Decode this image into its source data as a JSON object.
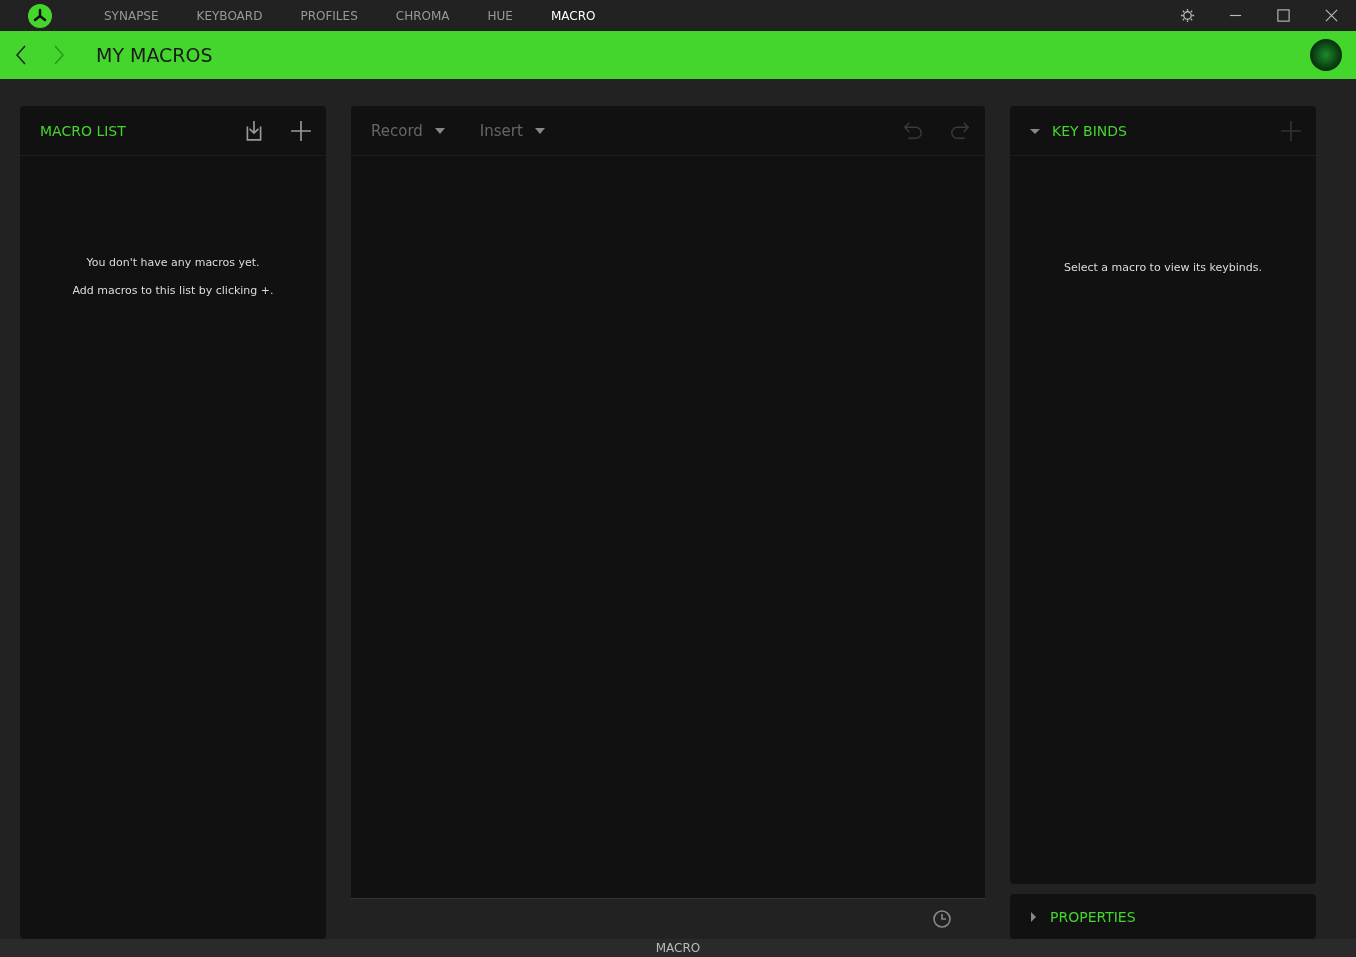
{
  "nav_tabs": [
    {
      "label": "SYNAPSE",
      "selected": false
    },
    {
      "label": "KEYBOARD",
      "selected": false
    },
    {
      "label": "PROFILES",
      "selected": false
    },
    {
      "label": "CHROMA",
      "selected": false
    },
    {
      "label": "HUE",
      "selected": false
    },
    {
      "label": "MACRO",
      "selected": true
    }
  ],
  "header": {
    "title": "MY MACROS",
    "back_disabled": false,
    "forward_disabled": true
  },
  "macro_list": {
    "title": "MACRO LIST",
    "empty_lines": [
      "You don't have any macros yet.",
      "Add macros to this list by clicking +."
    ]
  },
  "editor": {
    "menus": [
      "Record",
      "Insert"
    ]
  },
  "key_binds": {
    "title": "KEY BINDS",
    "expanded": true,
    "empty_text": "Select a macro to view its keybinds."
  },
  "properties": {
    "title": "PROPERTIES",
    "expanded": false
  },
  "footer_label": "MACRO"
}
